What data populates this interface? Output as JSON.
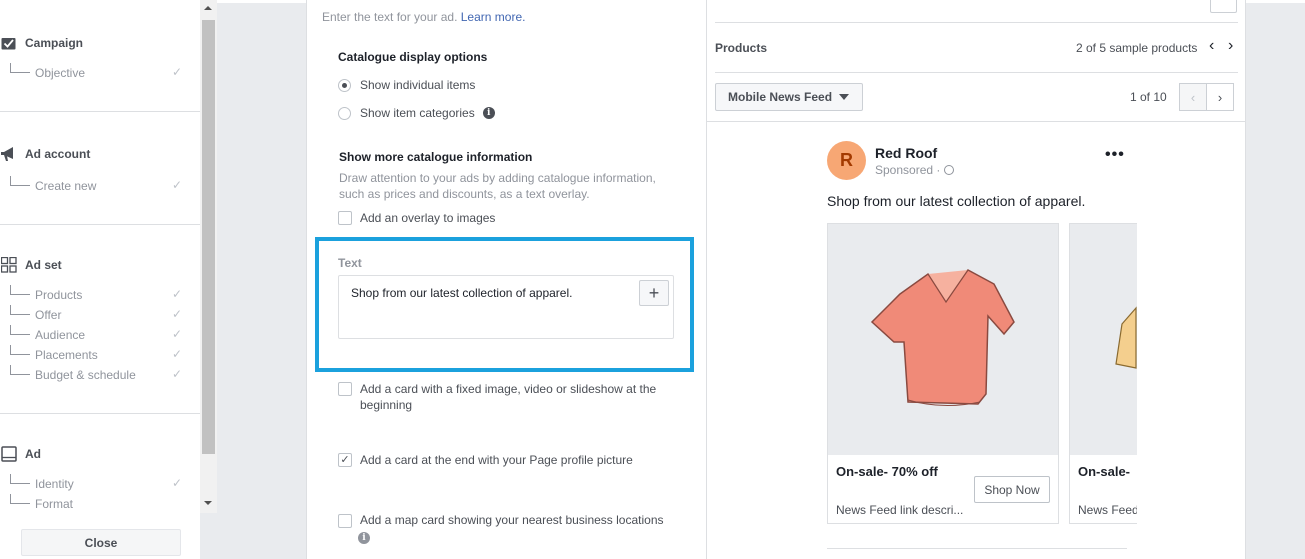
{
  "sidebar": {
    "campaign": {
      "label": "Campaign",
      "items": [
        {
          "label": "Objective"
        }
      ]
    },
    "ad_account": {
      "label": "Ad account",
      "items": [
        {
          "label": "Create new"
        }
      ]
    },
    "ad_set": {
      "label": "Ad set",
      "items": [
        {
          "label": "Products"
        },
        {
          "label": "Offer"
        },
        {
          "label": "Audience"
        },
        {
          "label": "Placements"
        },
        {
          "label": "Budget & schedule"
        }
      ]
    },
    "ad": {
      "label": "Ad",
      "items": [
        {
          "label": "Identity"
        },
        {
          "label": "Format"
        }
      ]
    },
    "close_label": "Close"
  },
  "form": {
    "links_hint": "Enter the text for your ad.",
    "learn_more": "Learn more.",
    "catalogue_display_title": "Catalogue display options",
    "options": [
      {
        "label": "Show individual items",
        "selected": true
      },
      {
        "label": "Show item categories",
        "selected": false
      }
    ],
    "more_info_title": "Show more catalogue information",
    "more_info_desc_1": "Draw attention to your ads by adding catalogue information,",
    "more_info_desc_2": "such as prices and discounts, as a text overlay.",
    "overlay_label": "Add an overlay to images",
    "text_label": "Text",
    "text_value": "Shop from our latest collection of apparel.",
    "card_start_label_1": "Add a card with a fixed image, video or slideshow at the",
    "card_start_label_2": "beginning",
    "card_end_label": "Add a card at the end with your Page profile picture",
    "map_card_label": "Add a map card showing your nearest business locations"
  },
  "preview": {
    "products_label": "Products",
    "sample_count": "2 of 5 sample products",
    "placement": "Mobile News Feed",
    "page_counter": "1 of 10",
    "page_name": "Red Roof",
    "avatar_letter": "R",
    "sponsored": "Sponsored ·",
    "primary_text": "Shop from our latest collection of apparel.",
    "cards": [
      {
        "title": "On-sale- 70% off",
        "desc": "News Feed link descri...",
        "cta": "Shop Now"
      },
      {
        "title": "On-sale-",
        "desc": "News Feed"
      }
    ]
  },
  "colors": {
    "highlight": "#1ba1dd",
    "link": "#4267b2",
    "avatar": "#f7a774"
  }
}
